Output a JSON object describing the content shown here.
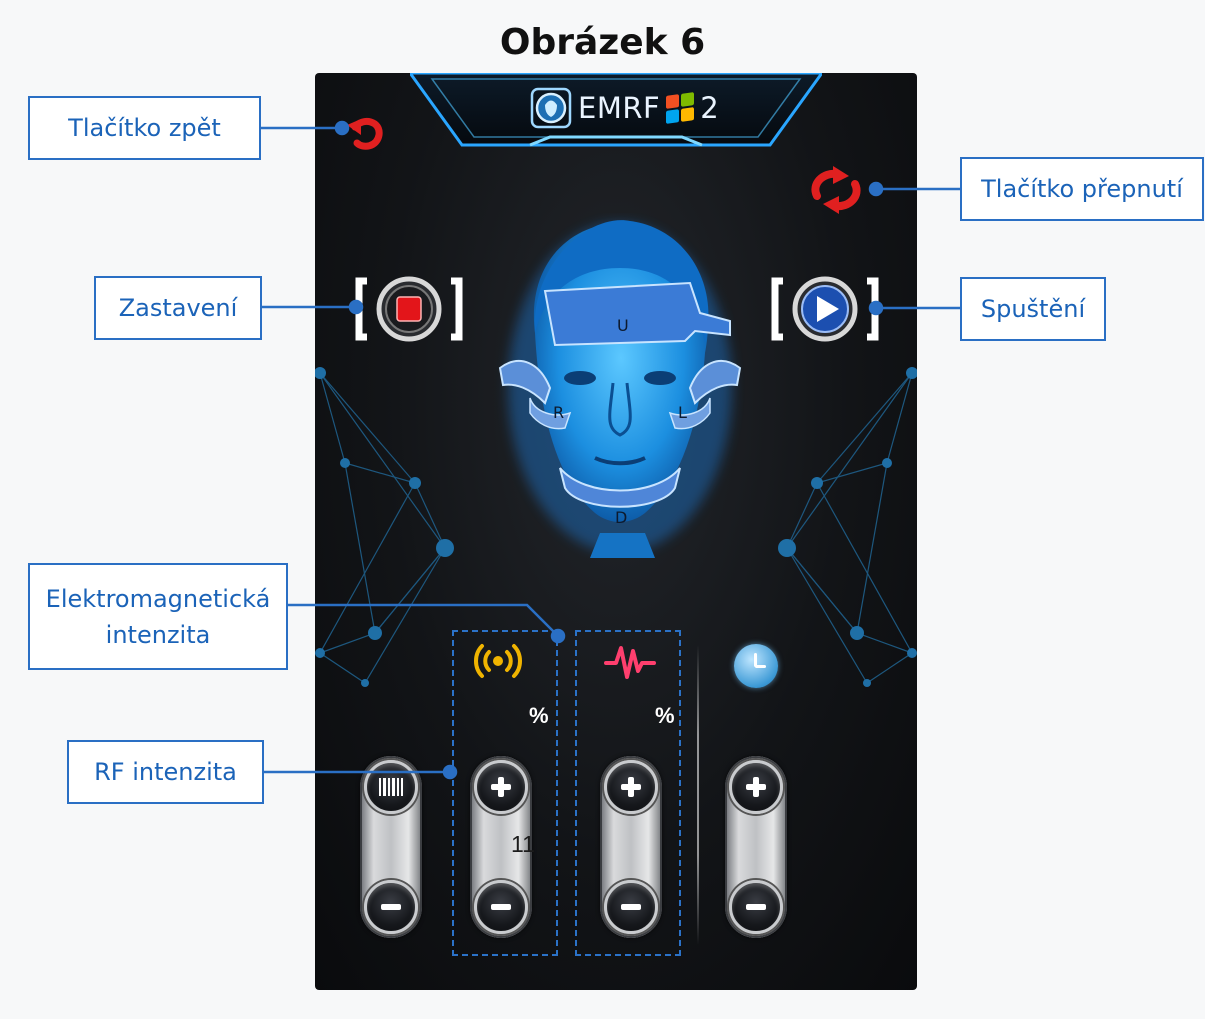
{
  "figure": {
    "title": "Obrázek 6"
  },
  "header": {
    "brand_text": "EMRF",
    "brand_number": "2"
  },
  "face_labels": {
    "up": "U",
    "right": "R",
    "left": "L",
    "down": "D"
  },
  "controls": {
    "em_unit": "%",
    "rf_unit": "%",
    "em_value": "11"
  },
  "callouts": {
    "back": "Tlačítko zpět",
    "switch": "Tlačítko přepnutí",
    "stop": "Zastavení",
    "start": "Spuštění",
    "em_line1": "Elektromagnetická",
    "em_line2": "intenzita",
    "rf": "RF intenzita"
  },
  "colors": {
    "accent_blue": "#2a6fc4",
    "red_icons": "#e02020",
    "rf_icon": "#f0b400",
    "wave_icon": "#ff3f6e",
    "clock_icon": "#3d9ad6"
  },
  "icons": [
    "back-arrow-icon",
    "switch-arrows-icon",
    "stop-icon",
    "play-icon",
    "signal-icon",
    "wave-icon",
    "clock-icon",
    "plus-icon",
    "minus-icon",
    "barcode-icon"
  ]
}
